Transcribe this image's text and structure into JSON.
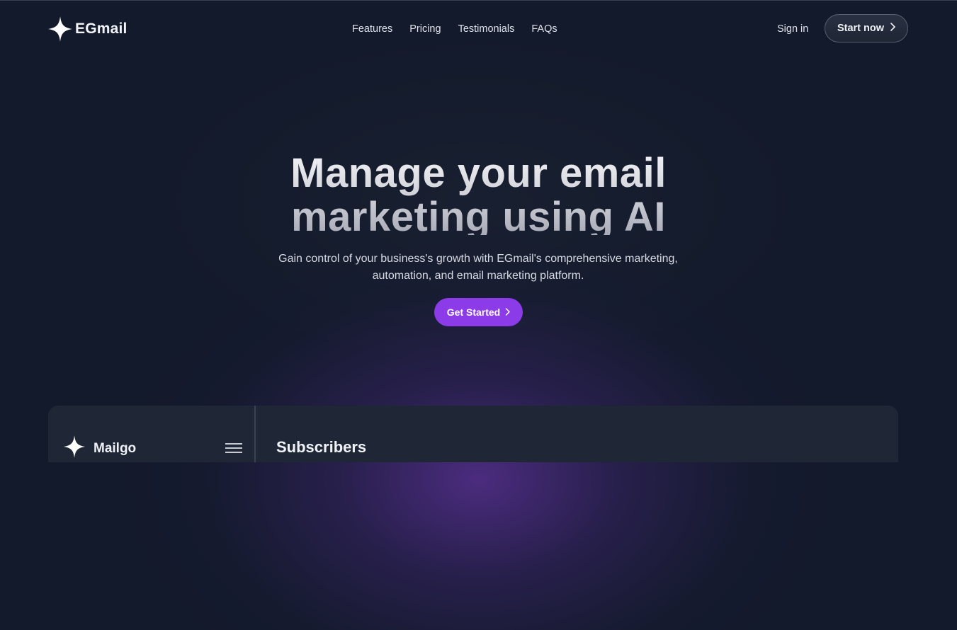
{
  "brand": {
    "name": "EGmail",
    "icon": "sparkle-star-icon"
  },
  "nav": {
    "links": [
      "Features",
      "Pricing",
      "Testimonials",
      "FAQs"
    ],
    "sign_in": "Sign in",
    "start_now": "Start now"
  },
  "hero": {
    "title_line1": "Manage your email",
    "title_line2": "marketing using AI",
    "subtitle": "Gain control of your business's growth with EGmail's comprehensive marketing, automation, and email marketing platform.",
    "cta": "Get Started"
  },
  "preview": {
    "app_name": "Mailgo",
    "heading": "Subscribers"
  },
  "colors": {
    "background": "#131a2b",
    "accent": "#8b3be8",
    "panel": "#1f2737"
  }
}
